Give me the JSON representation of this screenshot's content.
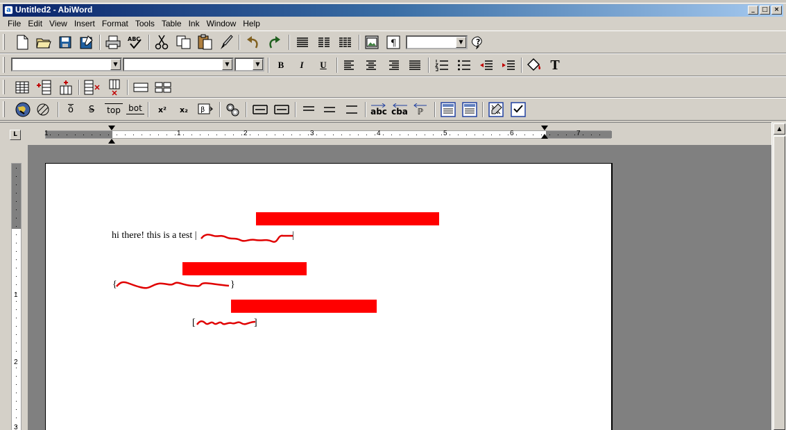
{
  "window": {
    "title": "Untitled2 - AbiWord",
    "controls": [
      "_",
      "□",
      "×"
    ]
  },
  "menubar": {
    "items": [
      "File",
      "Edit",
      "View",
      "Insert",
      "Format",
      "Tools",
      "Table",
      "Ink",
      "Window",
      "Help"
    ]
  },
  "format_toolbar": {
    "bold": "B",
    "italic": "I",
    "underline": "U",
    "text_icon": "T"
  },
  "extra_toolbar": {
    "overline": "ō",
    "strike": "S",
    "topline": "top",
    "bottomline": "bot",
    "superscript": "x²",
    "subscript": "x₂",
    "ltr": "abc",
    "rtl": "cba",
    "para_dir": "ℙ"
  },
  "ruler": {
    "numbers": [
      "1",
      "1",
      "2",
      "3",
      "4",
      "5",
      "6",
      "7"
    ],
    "vertical_numbers": [
      "1",
      "2",
      "3"
    ],
    "tab_icon": "L"
  },
  "document": {
    "line1": "hi there! this is a test |",
    "line1_end": "|",
    "line2_open": "{",
    "line2_close": "}",
    "line3_open": "[",
    "line3_close": "]"
  },
  "colors": {
    "redaction": "#ff0000",
    "scribble": "#e00000",
    "titlebar_start": "#0a246a",
    "titlebar_end": "#a6caf0"
  },
  "icons": {
    "standard_toolbar": [
      "new-document-icon",
      "open-folder-icon",
      "save-icon",
      "save-as-icon",
      "print-icon",
      "spellcheck-icon",
      "cut-icon",
      "copy-icon",
      "paste-icon",
      "format-painter-icon",
      "undo-icon",
      "redo-icon",
      "align-left-icon",
      "align-justify-icon",
      "columns-icon",
      "insert-image-icon",
      "paragraph-mark-icon",
      "help-icon"
    ],
    "table_toolbar": [
      "insert-table-icon",
      "insert-row-icon",
      "insert-column-icon",
      "delete-row-icon",
      "delete-column-icon",
      "merge-cells-icon",
      "split-cells-icon"
    ],
    "extra_toolbar": [
      "web-globe-icon",
      "hyperlink-icon",
      "insert-symbol-icon",
      "zoom-whole-icon",
      "zoom-width-icon",
      "header-icon",
      "footer-icon"
    ]
  }
}
